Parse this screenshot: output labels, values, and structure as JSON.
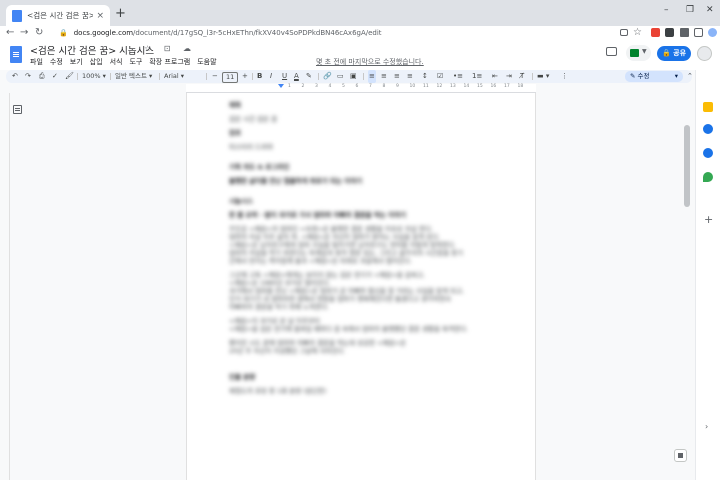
{
  "browser": {
    "tab_title": "<검은 시간 검은 꿈> 시놉시스",
    "tab_close": "×",
    "new_tab": "+",
    "url_domain": "docs.google.com",
    "url_path": "/document/d/17gSQ_l3r-5cHxEThn/fkXV40v4SoPDPkdBN46cAx6gA/edit",
    "win_min": "–",
    "win_max": "❐",
    "win_close": "✕",
    "nav_back": "←",
    "nav_forward": "→",
    "nav_reload": "↻"
  },
  "docs": {
    "title": "<검은 시간 검은 꿈> 시놉시스",
    "title_icons": "☆ ⊡ ☁",
    "menu": [
      "파일",
      "수정",
      "보기",
      "삽입",
      "서식",
      "도구",
      "확장 프로그램",
      "도움말"
    ],
    "last_edit": "몇 초 전에 마지막으로 수정했습니다.",
    "share_label": "공유"
  },
  "toolbar": {
    "zoom": "100%",
    "style": "일반 텍스트",
    "font": "Arial",
    "font_size": "11",
    "edit_mode": "수정",
    "bold": "B",
    "italic": "I",
    "underline": "U",
    "text_color": "A"
  },
  "ruler_ticks": [
    "1",
    "2",
    "3",
    "4",
    "5",
    "6",
    "7",
    "8",
    "9",
    "10",
    "11",
    "12",
    "13",
    "14",
    "15",
    "16",
    "17",
    "18"
  ],
  "document": {
    "h_title": "제목",
    "title_value": "검은 시간 검은 꿈",
    "h_genre": "장르",
    "genre_value": "미스터리 드라마",
    "h_logline": "기획 의도 & 로그라인",
    "logline_value": "불행한 삶이를 만난 철물하게 위로가 되는 이야기",
    "h_synopsis": "시놉시스",
    "synopsis_lead": "한 줄 요약 - 밤이 과거로 가서 엄마와 아빠의 결혼을 막는 이야기",
    "p1": [
      "주인공 <채원>의 엄마인 <숙영>은 불행한 결혼 생활을 이유로 자살 한다.",
      "엄마의 자살 이후 삶의 희, <채원>은 자신이 엄마가 받아는 사실을 알게 된다.",
      "<채원>은 남자친구에게 엄마 사실을 털어가면 남자친구는 면허를 어렵게 탈락한다.",
      "엄마의 자살을 막기 위한다는 외계감과 회적 절망 있는, 그리고 굶주리의 시간들을 용기",
      "간에서 번지는 쪽어들에 물과 <채원>은 미래로 과출에서 떨어진다."
    ],
    "p2": [
      "그곳에 고독 <채원>에게는 보이지 않는 검은 연기가 <채원>을 감싸고,",
      "<채원>은 1980년 과거로 떨어진다.",
      "과거에서 엄마를 만난 <채원>은 엄마가 곧 아빠와 함신을 할 거라는 사실을 알게 되고,",
      "인식 대기가 내 엄마라면 쌈에서 변환을 엄마가 행복해진다면 돌겠다고 생각하면서",
      "아빠와의 결혼을 막기 위해 노력한다."
    ],
    "p3": [
      "<채원>이 과거로 온 날 이후부터",
      "<채원>을 검은 연기에 휩싸일 때마다 꿈 속에서 엄마의 불행했던 결혼 생활을 목격한다."
    ],
    "p4": [
      "했지만 시도 끝에 엄마와 아빠의 결혼을 막는데 성공한 <채원>은",
      "20년 후 자신이 지냈했던 그날에 사라진다."
    ],
    "h_characters": "인물 분량",
    "characters_value": "제철도의 포탕 중 1화 분량 (원단한)"
  }
}
